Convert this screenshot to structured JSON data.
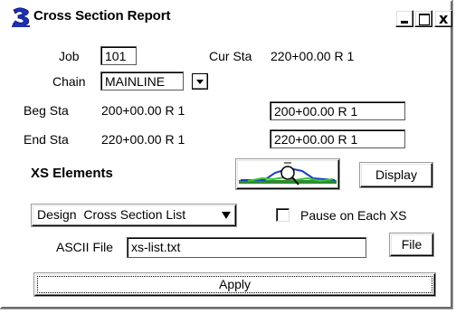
{
  "window": {
    "title": "Cross Section Report",
    "logo_icon": "geopak-logo-icon",
    "controls": {
      "minimize_icon": "minimize-icon",
      "maximize_icon": "maximize-icon",
      "close_glyph": "x"
    }
  },
  "job": {
    "label": "Job",
    "value": "101"
  },
  "cur_sta": {
    "label": "Cur Sta",
    "value": "220+00.00 R 1"
  },
  "chain": {
    "label": "Chain",
    "value": "MAINLINE"
  },
  "beg_sta": {
    "label": "Beg Sta",
    "display": "200+00.00 R 1",
    "value": "200+00.00 R 1"
  },
  "end_sta": {
    "label": "End Sta",
    "display": "220+00.00 R 1",
    "value": "220+00.00 R 1"
  },
  "xs_elements": {
    "label": "XS Elements",
    "icon": "cross-section-view-icon",
    "display_label": "Display"
  },
  "design_select": {
    "value": "Design  Cross Section List"
  },
  "pause_checkbox": {
    "label": "Pause on Each XS",
    "checked": false
  },
  "ascii_file": {
    "label": "ASCII File",
    "value": "xs-list.txt",
    "file_label": "File"
  },
  "apply_label": "Apply"
}
